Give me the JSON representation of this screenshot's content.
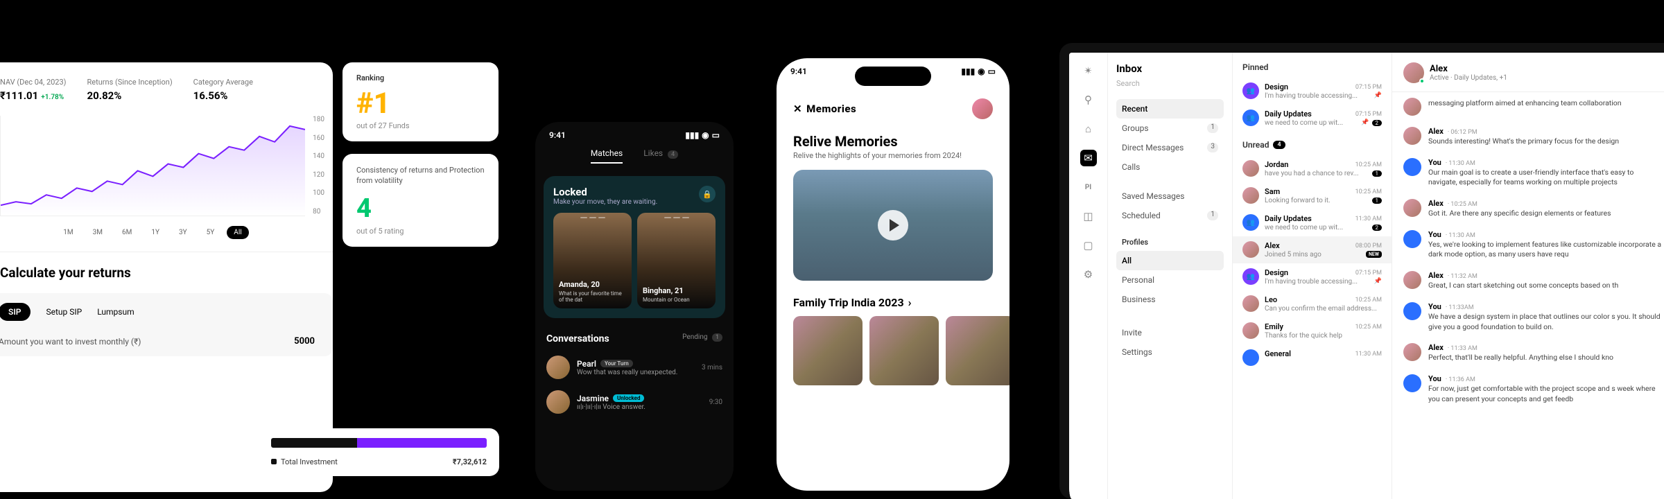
{
  "finance": {
    "metrics": {
      "nav_label": "NAV (Dec 04, 2023)",
      "nav_value": "₹111.01",
      "nav_delta": "+1.78%",
      "returns_label": "Returns (Since Inception)",
      "returns_value": "20.82%",
      "avg_label": "Category Average",
      "avg_value": "16.56%"
    },
    "yticks": [
      "180",
      "160",
      "140",
      "120",
      "100",
      "80"
    ],
    "ranges": [
      "1M",
      "3M",
      "6M",
      "1Y",
      "3Y",
      "5Y",
      "All"
    ],
    "active_range": "All",
    "calc_heading": "Calculate your returns",
    "invest_tabs": [
      "SIP",
      "Setup SIP",
      "Lumpsum"
    ],
    "active_invest_tab": "SIP",
    "invest_question": "Amount you want to invest monthly (₹)",
    "invest_amount": "5000",
    "ranking_label": "Ranking",
    "ranking_value": "#1",
    "ranking_sub": "out of 27 Funds",
    "cons_desc": "Consistency of returns and Protection from volatility",
    "cons_value": "4",
    "cons_sub": "out of 5 rating",
    "total_label": "Total Investment",
    "total_value": "₹7,32,612"
  },
  "dating": {
    "time": "9:41",
    "tabs": {
      "matches": "Matches",
      "likes": "Likes",
      "likes_count": "4"
    },
    "locked_title": "Locked",
    "locked_sub": "Make your move, they are waiting.",
    "profiles": [
      {
        "name": "Amanda, 20",
        "meta": "What is your favorite time of the dat"
      },
      {
        "name": "Binghan, 21",
        "meta": "Mountain or Ocean"
      }
    ],
    "conv_title": "Conversations",
    "pending": "Pending",
    "pending_count": "1",
    "convs": [
      {
        "name": "Pearl",
        "pill": "Your Turn",
        "pill_style": "gray",
        "msg": "Wow that was really unexpected.",
        "time": "3 mins"
      },
      {
        "name": "Jasmine",
        "pill": "Unlocked",
        "pill_style": "teal",
        "msg": "Voice answer.",
        "time": "9:30",
        "voice": true
      }
    ]
  },
  "memories": {
    "time": "9:41",
    "brand": "Memories",
    "title": "Relive Memories",
    "subtitle": "Relive the highlights of your memories from 2024!",
    "section": "Family Trip India 2023"
  },
  "inbox": {
    "title": "Inbox",
    "search": "Search",
    "nav": [
      {
        "label": "Recent",
        "active": true
      },
      {
        "label": "Groups",
        "badge": "1"
      },
      {
        "label": "Direct Messages",
        "badge": "3"
      },
      {
        "label": "Calls"
      }
    ],
    "nav2": [
      {
        "label": "Saved Messages"
      },
      {
        "label": "Scheduled",
        "badge": "1"
      }
    ],
    "profiles_label": "Profiles",
    "profiles": [
      {
        "label": "All",
        "active": true
      },
      {
        "label": "Personal"
      },
      {
        "label": "Business"
      }
    ],
    "footer": [
      "Invite",
      "Settings"
    ],
    "pinned_label": "Pinned",
    "pinned": [
      {
        "name": "Design",
        "time": "07:15 PM",
        "prev": "I'm having trouble accessing...",
        "pin": true,
        "av": "purple",
        "icon": "👥"
      },
      {
        "name": "Daily Updates",
        "time": "07:15 PM",
        "prev": "we need to come up wit...",
        "pin": true,
        "badge": "2",
        "av": "blue",
        "icon": "👥"
      }
    ],
    "unread_label": "Unread",
    "unread_count": "4",
    "unread": [
      {
        "name": "Jordan",
        "time": "10:25 AM",
        "prev": "have you had a chance to rev...",
        "badge": "1",
        "av": "photo"
      },
      {
        "name": "Sam",
        "time": "10:25 AM",
        "prev": "Looking forward to it.",
        "badge": "1",
        "av": "photo"
      },
      {
        "name": "Daily Updates",
        "time": "11:30 AM",
        "prev": "we need to come up wit...",
        "badge": "2",
        "av": "blue",
        "icon": "👥"
      },
      {
        "name": "Alex",
        "time": "08:00 PM",
        "prev": "Joined 5 mins ago",
        "new": true,
        "av": "photo",
        "sel": true
      },
      {
        "name": "Design",
        "time": "07:15 PM",
        "prev": "I'm having trouble accessing...",
        "pin": true,
        "av": "purple",
        "icon": "👥"
      },
      {
        "name": "Leo",
        "time": "10:25 AM",
        "prev": "Can you confirm the email address...",
        "av": "photo"
      },
      {
        "name": "Emily",
        "time": "10:25 AM",
        "prev": "Thanks for the quick help",
        "av": "photo"
      },
      {
        "name": "General",
        "time": "11:30 AM",
        "prev": "",
        "av": "blue"
      }
    ],
    "chat": {
      "name": "Alex",
      "status": "Active",
      "sub": "Daily Updates, +1",
      "messages": [
        {
          "author": "",
          "time": "",
          "text": "messaging platform aimed at enhancing team collaboration"
        },
        {
          "author": "Alex",
          "time": "06:12 PM",
          "text": "Sounds interesting! What's the primary focus for the design"
        },
        {
          "author": "You",
          "time": "11:30 AM",
          "text": "Our main goal is to create a user-friendly interface that's easy to navigate, especially for teams working on multiple projects"
        },
        {
          "author": "Alex",
          "time": "10:25 AM",
          "text": "Got it. Are there any specific design elements or features"
        },
        {
          "author": "You",
          "time": "11:30 AM",
          "text": "Yes, we're looking to implement features like customizable incorporate a dark mode option, as many users have requ"
        },
        {
          "author": "Alex",
          "time": "11:32 AM",
          "text": "Great, I can start sketching out some concepts based on th"
        },
        {
          "author": "You",
          "time": "11:33AM",
          "text": "We have a design system in place that outlines our color s you. It should give you a good foundation to build on."
        },
        {
          "author": "Alex",
          "time": "11:33 AM",
          "text": "Perfect, that'll be really helpful. Anything else I should kno"
        },
        {
          "author": "You",
          "time": "11:36 AM",
          "text": "For now, just get comfortable with the project scope and s week where you can present your concepts and get feedb"
        }
      ]
    }
  }
}
